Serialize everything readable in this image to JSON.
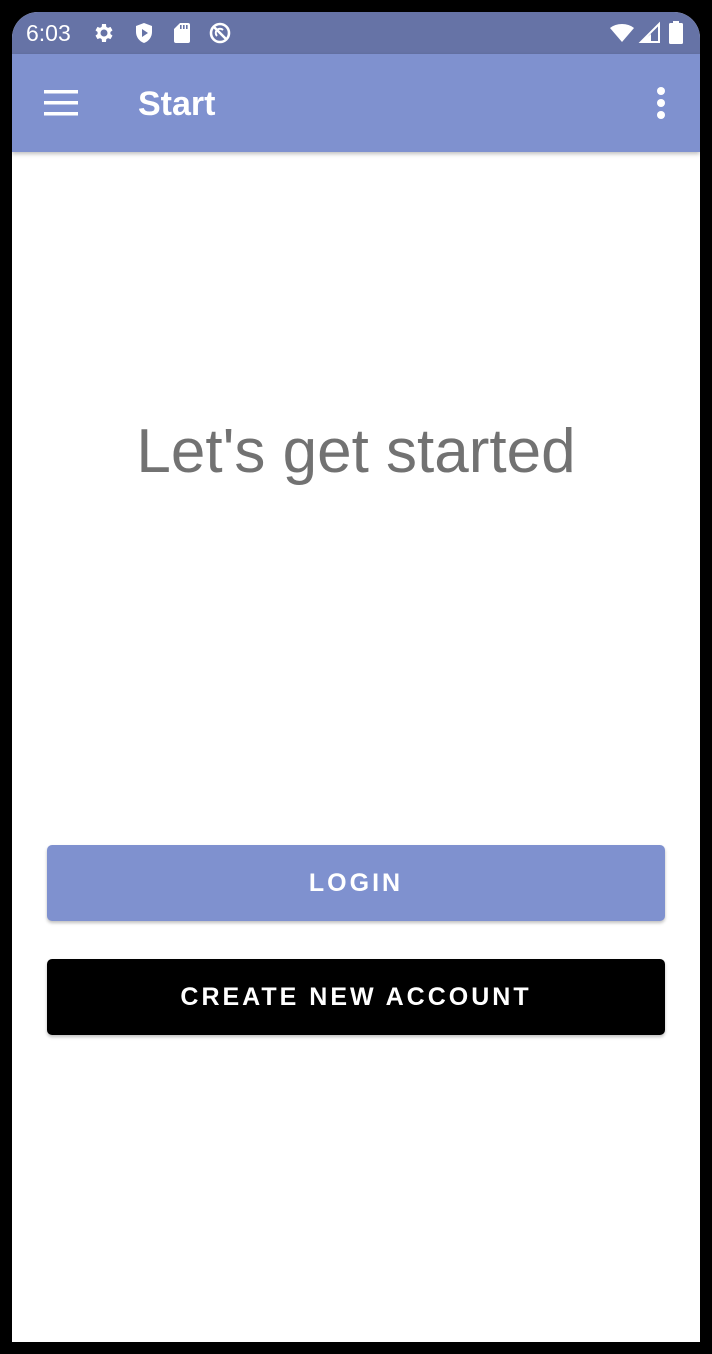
{
  "status_bar": {
    "time": "6:03",
    "left_icons": [
      "gear-icon",
      "shield-play-icon",
      "sd-card-icon",
      "no-sync-icon"
    ],
    "right_icons": [
      "wifi-icon",
      "cell-signal-icon",
      "battery-icon"
    ]
  },
  "app_bar": {
    "title": "Start",
    "menu_icon": "hamburger-menu-icon",
    "overflow_icon": "more-vert-icon"
  },
  "main": {
    "headline": "Let's get started",
    "login_label": "LOGIN",
    "create_account_label": "CREATE NEW ACCOUNT"
  },
  "colors": {
    "status_bar": "#6673a6",
    "app_bar": "#7f91cf",
    "login_button": "#7f91cf",
    "create_button": "#000000",
    "headline_text": "#727272"
  }
}
